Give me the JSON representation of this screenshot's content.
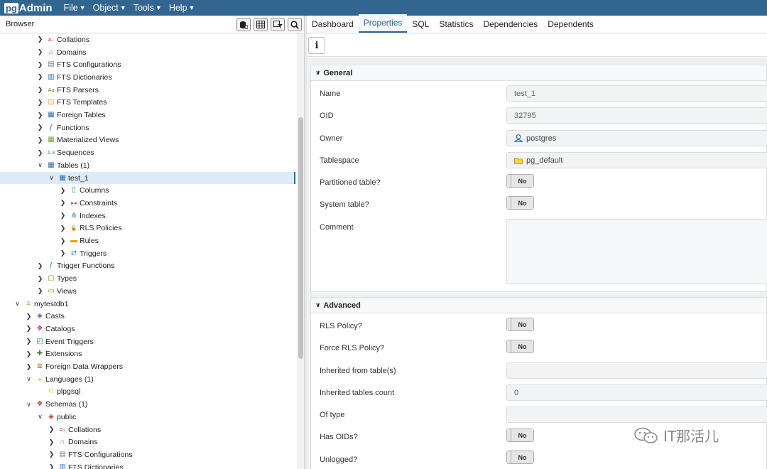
{
  "app": {
    "logo_pg": "pg",
    "logo_admin": "Admin"
  },
  "menus": [
    "File",
    "Object",
    "Tools",
    "Help"
  ],
  "browser": {
    "title": "Browser",
    "tools": [
      "query-tool-icon",
      "view-data-icon",
      "filter-icon",
      "search-icon"
    ],
    "rows": [
      {
        "label": "Collations",
        "depth": 3,
        "expand": "collapsed",
        "icon": "collation-icon"
      },
      {
        "label": "Domains",
        "depth": 3,
        "expand": "collapsed",
        "icon": "domain-icon"
      },
      {
        "label": "FTS Configurations",
        "depth": 3,
        "expand": "collapsed",
        "icon": "fts-config-icon"
      },
      {
        "label": "FTS Dictionaries",
        "depth": 3,
        "expand": "collapsed",
        "icon": "fts-dict-icon"
      },
      {
        "label": "FTS Parsers",
        "depth": 3,
        "expand": "collapsed",
        "icon": "fts-parser-icon"
      },
      {
        "label": "FTS Templates",
        "depth": 3,
        "expand": "collapsed",
        "icon": "fts-template-icon"
      },
      {
        "label": "Foreign Tables",
        "depth": 3,
        "expand": "collapsed",
        "icon": "foreign-table-icon"
      },
      {
        "label": "Functions",
        "depth": 3,
        "expand": "collapsed",
        "icon": "function-icon"
      },
      {
        "label": "Materialized Views",
        "depth": 3,
        "expand": "collapsed",
        "icon": "mview-icon"
      },
      {
        "label": "Sequences",
        "depth": 3,
        "expand": "collapsed",
        "icon": "sequence-icon"
      },
      {
        "label": "Tables (1)",
        "depth": 3,
        "expand": "expanded",
        "icon": "tables-icon"
      },
      {
        "label": "test_1",
        "depth": 4,
        "expand": "expanded",
        "icon": "table-icon",
        "selected": true
      },
      {
        "label": "Columns",
        "depth": 5,
        "expand": "collapsed",
        "icon": "columns-icon"
      },
      {
        "label": "Constraints",
        "depth": 5,
        "expand": "collapsed",
        "icon": "constraints-icon"
      },
      {
        "label": "Indexes",
        "depth": 5,
        "expand": "collapsed",
        "icon": "indexes-icon"
      },
      {
        "label": "RLS Policies",
        "depth": 5,
        "expand": "collapsed",
        "icon": "rls-policy-icon"
      },
      {
        "label": "Rules",
        "depth": 5,
        "expand": "collapsed",
        "icon": "rules-icon"
      },
      {
        "label": "Triggers",
        "depth": 5,
        "expand": "collapsed",
        "icon": "triggers-icon"
      },
      {
        "label": "Trigger Functions",
        "depth": 3,
        "expand": "collapsed",
        "icon": "trigger-function-icon"
      },
      {
        "label": "Types",
        "depth": 3,
        "expand": "collapsed",
        "icon": "types-icon"
      },
      {
        "label": "Views",
        "depth": 3,
        "expand": "collapsed",
        "icon": "views-icon"
      },
      {
        "label": "mytestdb1",
        "depth": 1,
        "expand": "expanded",
        "icon": "database-icon"
      },
      {
        "label": "Casts",
        "depth": 2,
        "expand": "collapsed",
        "icon": "casts-icon"
      },
      {
        "label": "Catalogs",
        "depth": 2,
        "expand": "collapsed",
        "icon": "catalogs-icon"
      },
      {
        "label": "Event Triggers",
        "depth": 2,
        "expand": "collapsed",
        "icon": "event-trigger-icon"
      },
      {
        "label": "Extensions",
        "depth": 2,
        "expand": "collapsed",
        "icon": "extensions-icon"
      },
      {
        "label": "Foreign Data Wrappers",
        "depth": 2,
        "expand": "collapsed",
        "icon": "fdw-icon"
      },
      {
        "label": "Languages (1)",
        "depth": 2,
        "expand": "expanded",
        "icon": "languages-icon"
      },
      {
        "label": "plpgsql",
        "depth": 3,
        "expand": "none",
        "icon": "language-icon"
      },
      {
        "label": "Schemas (1)",
        "depth": 2,
        "expand": "expanded",
        "icon": "schemas-icon"
      },
      {
        "label": "public",
        "depth": 3,
        "expand": "expanded",
        "icon": "schema-icon"
      },
      {
        "label": "Collations",
        "depth": 4,
        "expand": "collapsed",
        "icon": "collation-icon"
      },
      {
        "label": "Domains",
        "depth": 4,
        "expand": "collapsed",
        "icon": "domain-icon"
      },
      {
        "label": "FTS Configurations",
        "depth": 4,
        "expand": "collapsed",
        "icon": "fts-config-icon"
      },
      {
        "label": "FTS Dictionaries",
        "depth": 4,
        "expand": "collapsed",
        "icon": "fts-dict-icon"
      }
    ]
  },
  "tabs": [
    {
      "label": "Dashboard",
      "active": false
    },
    {
      "label": "Properties",
      "active": true
    },
    {
      "label": "SQL",
      "active": false
    },
    {
      "label": "Statistics",
      "active": false
    },
    {
      "label": "Dependencies",
      "active": false
    },
    {
      "label": "Dependents",
      "active": false
    }
  ],
  "info_button": "i",
  "general": {
    "title": "General",
    "name_label": "Name",
    "name_value": "test_1",
    "oid_label": "OID",
    "oid_value": "32795",
    "owner_label": "Owner",
    "owner_value": "postgres",
    "tablespace_label": "Tablespace",
    "tablespace_value": "pg_default",
    "partitioned_label": "Partitioned table?",
    "partitioned_value": "No",
    "system_label": "System table?",
    "system_value": "No",
    "comment_label": "Comment",
    "comment_value": ""
  },
  "advanced": {
    "title": "Advanced",
    "rls_label": "RLS Policy?",
    "rls_value": "No",
    "force_rls_label": "Force RLS Policy?",
    "force_rls_value": "No",
    "inherited_label": "Inherited from table(s)",
    "inherited_value": "",
    "inherited_count_label": "Inherited tables count",
    "inherited_count_value": "0",
    "of_type_label": "Of type",
    "of_type_value": "",
    "has_oids_label": "Has OIDs?",
    "has_oids_value": "No",
    "unlogged_label": "Unlogged?",
    "unlogged_value": "No"
  },
  "watermark": "IT那活儿",
  "colors": {
    "navbar": "#326690",
    "selected_row": "#dcebf7",
    "accent": "#326690"
  }
}
